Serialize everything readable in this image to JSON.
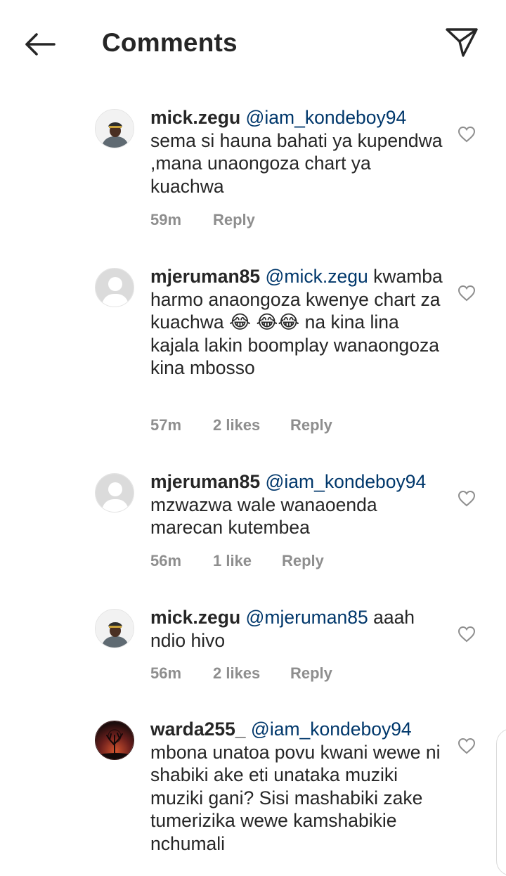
{
  "header": {
    "title": "Comments",
    "back_icon": "arrow-left-icon",
    "share_icon": "paper-plane-icon"
  },
  "colors": {
    "text": "#262626",
    "mention": "#00376b",
    "meta": "#8e8e8e"
  },
  "comments": [
    {
      "username": "mick.zegu",
      "mention": "@iam_kondeboy94",
      "text": "sema si hauna bahati ya kupendwa ,mana unaongoza chart ya kuachwa",
      "time": "59m",
      "likes": "",
      "reply": "Reply",
      "avatar": "photo-man-cap"
    },
    {
      "username": "mjeruman85",
      "mention": "@mick.zegu",
      "text_part1": "kwamba harmo anaongoza kwenye chart za kuachwa",
      "text_emoji": "😂",
      "text_emoji2": "😂😂",
      "text_part2": "na kina lina kajala lakin boomplay wanaongoza kina mbosso",
      "time": "57m",
      "likes": "2 likes",
      "reply": "Reply",
      "avatar": "default-avatar"
    },
    {
      "username": "mjeruman85",
      "mention": "@iam_kondeboy94",
      "text": "mzwazwa wale wanaoenda marecan kutembea",
      "time": "56m",
      "likes": "1 like",
      "reply": "Reply",
      "avatar": "default-avatar"
    },
    {
      "username": "mick.zegu",
      "mention": "@mjeruman85",
      "text": "aaah ndio hivo",
      "time": "56m",
      "likes": "2 likes",
      "reply": "Reply",
      "avatar": "photo-man-cap"
    },
    {
      "username": "warda255_",
      "mention": "@iam_kondeboy94",
      "text": "mbona unatoa povu kwani wewe ni shabiki ake eti unataka muziki  muziki gani?  Sisi mashabiki zake tumerizika wewe kamshabikie nchumali",
      "time": "",
      "likes": "",
      "reply": "",
      "avatar": "photo-tree-sunset"
    }
  ]
}
